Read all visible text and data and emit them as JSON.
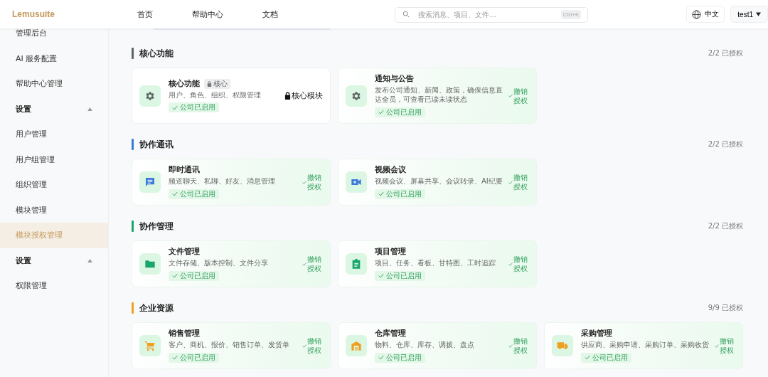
{
  "header": {
    "logo": "Lemusuite",
    "nav": [
      {
        "label": "首页"
      },
      {
        "label": "帮助中心"
      },
      {
        "label": "文档"
      }
    ],
    "search": {
      "placeholder": "搜索消息、项目、文件...",
      "shortcut": "Ctrl+K"
    },
    "language": "中文",
    "user": "test1"
  },
  "sidebar": {
    "items": [
      {
        "kind": "item",
        "label": "管理后台",
        "selected": false
      },
      {
        "kind": "item",
        "label": "AI 服务配置",
        "selected": false
      },
      {
        "kind": "item",
        "label": "帮助中心管理",
        "selected": false
      },
      {
        "kind": "group",
        "label": "设置",
        "expanded": true
      },
      {
        "kind": "item",
        "label": "用户管理",
        "selected": false
      },
      {
        "kind": "item",
        "label": "用户组管理",
        "selected": false
      },
      {
        "kind": "item",
        "label": "组织管理",
        "selected": false
      },
      {
        "kind": "item",
        "label": "模块管理",
        "selected": false
      },
      {
        "kind": "item",
        "label": "模块授权管理",
        "selected": true
      },
      {
        "kind": "group",
        "label": "设置",
        "expanded": true
      },
      {
        "kind": "item",
        "label": "权限管理",
        "selected": false
      }
    ]
  },
  "sections": [
    {
      "title": "核心功能",
      "count": "2/2 已授权",
      "color": "#5b6660",
      "modules": [
        {
          "kind": "core",
          "name": "核心功能",
          "tag": "核心",
          "desc": "用户、角色、组织、权限管理",
          "status": "公司已启用",
          "action": "核心模块"
        },
        {
          "kind": "licensed",
          "name": "通知与公告",
          "desc": "发布公司通知、新闻、政策，确保信息直达全员，可查看已读未读状态",
          "status": "公司已启用",
          "action": "撤销授权"
        }
      ]
    },
    {
      "title": "协作通讯",
      "count": "2/2 已授权",
      "color": "#3b7bd8",
      "modules": [
        {
          "kind": "licensed",
          "name": "即时通讯",
          "desc": "频道聊天、私聊、好友、消息管理",
          "status": "公司已启用",
          "action": "撤销授权"
        },
        {
          "kind": "licensed",
          "name": "视频会议",
          "desc": "视频会议、屏幕共享、会议转录、AI纪要",
          "status": "公司已启用",
          "action": "撤销授权"
        }
      ]
    },
    {
      "title": "协作管理",
      "count": "2/2 已授权",
      "color": "#1aa56b",
      "modules": [
        {
          "kind": "licensed",
          "name": "文件管理",
          "desc": "文件存储、版本控制、文件分享",
          "status": "公司已启用",
          "action": "撤销授权"
        },
        {
          "kind": "licensed",
          "name": "项目管理",
          "desc": "项目、任务、看板、甘特图、工时追踪",
          "status": "公司已启用",
          "action": "撤销授权"
        }
      ]
    },
    {
      "title": "企业资源",
      "count": "9/9 已授权",
      "color": "#f0a020",
      "modules": [
        {
          "kind": "licensed",
          "name": "销售管理",
          "desc": "客户、商机、报价、销售订单、发货单",
          "status": "公司已启用",
          "action": "撤销授权"
        },
        {
          "kind": "licensed",
          "name": "仓库管理",
          "desc": "物料、仓库、库存、调拨、盘点",
          "status": "公司已启用",
          "action": "撤销授权"
        },
        {
          "kind": "licensed",
          "name": "采购管理",
          "desc": "供应商、采购申请、采购订单、采购收货",
          "status": "公司已启用",
          "action": "撤销授权"
        }
      ]
    }
  ]
}
